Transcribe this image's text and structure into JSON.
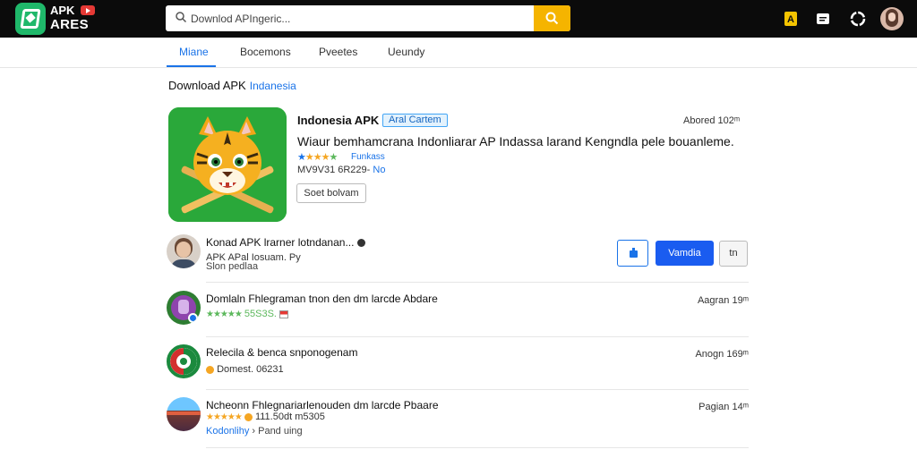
{
  "brand": {
    "line1": "APK",
    "line2": "ARES"
  },
  "search": {
    "placeholder": "Downlod APIngeric..."
  },
  "tabs": [
    {
      "label": "Miane",
      "active": true
    },
    {
      "label": "Bocemons"
    },
    {
      "label": "Pveetes"
    },
    {
      "label": "Ueundy"
    }
  ],
  "breadcrumb": {
    "main": "Download APK",
    "sub": "Indanesia"
  },
  "featured": {
    "title": "Indonesia APK",
    "badge": "Aral Cartem",
    "date": "Abored 102ᵐ",
    "description": "Wiaur bemhamcrana Indonliarar AP Indassa larand Kengndla pele bouanleme.",
    "stars": "★★★★★",
    "rating_label": "Funkass",
    "meta": "MV9V31 6R229-",
    "meta_highlight": "No",
    "button": "Soet bolvam"
  },
  "rows": [
    {
      "title": "Konad APK lrarner lotndanan...",
      "line2": "APK APal Iosuam. Py",
      "line3": "Slon pedlaa",
      "actions": {
        "primary": "Vamdia",
        "secondary": "tn"
      }
    },
    {
      "title": "Domlaln Fhlegraman tnon den dm larcde Abdare",
      "stars": "★★★★★",
      "stars_text": "55S3S.",
      "date": "Aagran 19ᵐ"
    },
    {
      "title": "Relecila & benca snponogenam",
      "line2": "Domest. 06231",
      "date": "Anogn 169ᵐ"
    },
    {
      "title": "Ncheonn Fhlegnariarlenouden dm larcde Pbaare",
      "stars": "★★★★★",
      "stars_text": "111.50dt m5305",
      "line3_link": "Kodonlihy",
      "line3_text": "› Pand uing",
      "date": "Pagian 14ᵐ"
    }
  ],
  "colors": {
    "accent": "#1a73e8",
    "search_button": "#f5b400",
    "topbar": "#0b0b0b",
    "brand_green": "#1fb86a"
  }
}
